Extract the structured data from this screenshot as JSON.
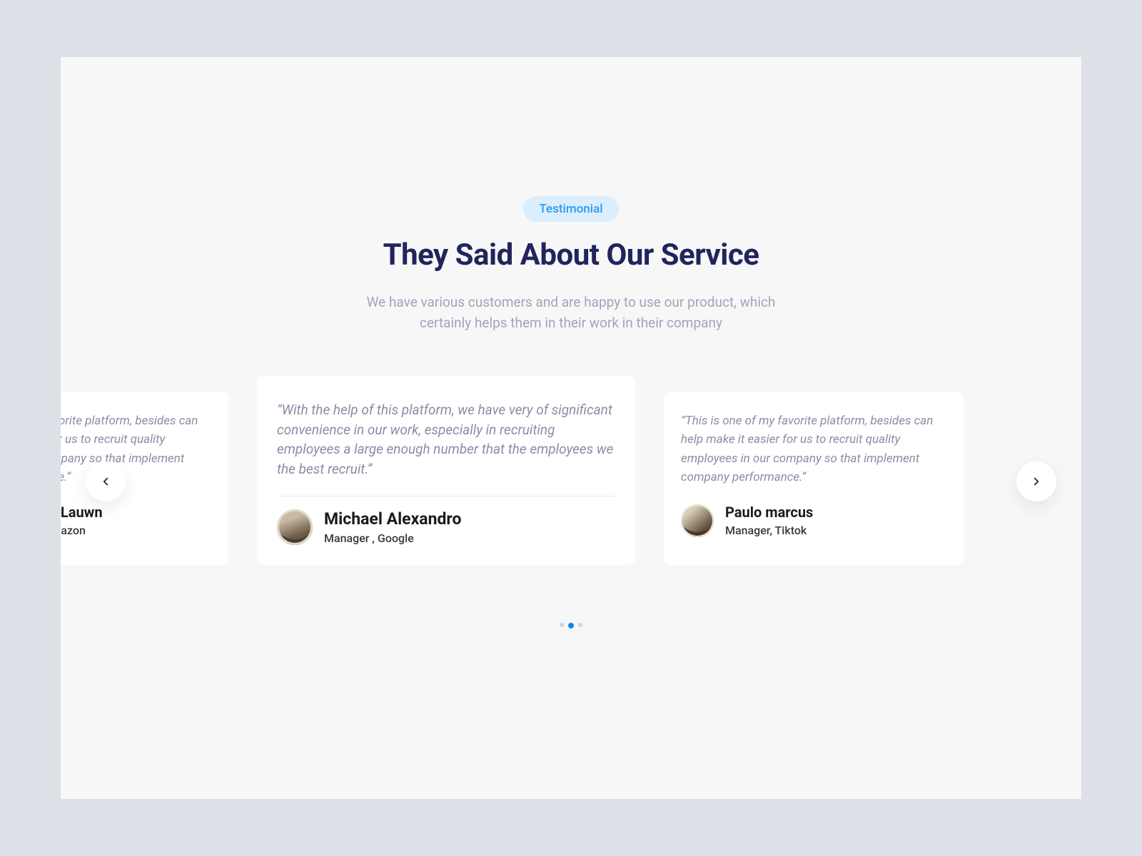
{
  "header": {
    "badge": "Testimonial",
    "title": "They Said About Our Service",
    "subtitle": "We have various customers and are happy to use our product, which certainly helps them in their work in their company"
  },
  "testimonials": {
    "left": {
      "quote": "“This is one of my favorite platform, besides can help make it easier for us to recruit quality employees in our company so that implement company performance.”",
      "name": "Margartha Lauwn",
      "title": "Manager , Amazon"
    },
    "center": {
      "quote": "“With the help of this platform, we have very of significant convenience in our work, especially in recruiting employees a large enough number that the employees we the best recruit.”",
      "name": "Michael Alexandro",
      "title": "Manager , Google"
    },
    "right": {
      "quote": "“This is one of my favorite platform, besides can help make it easier for us to recruit quality employees in our company so that implement company performance.”",
      "name": "Paulo marcus",
      "title": "Manager, Tiktok"
    }
  },
  "carousel": {
    "active_index": 1,
    "total": 3
  }
}
